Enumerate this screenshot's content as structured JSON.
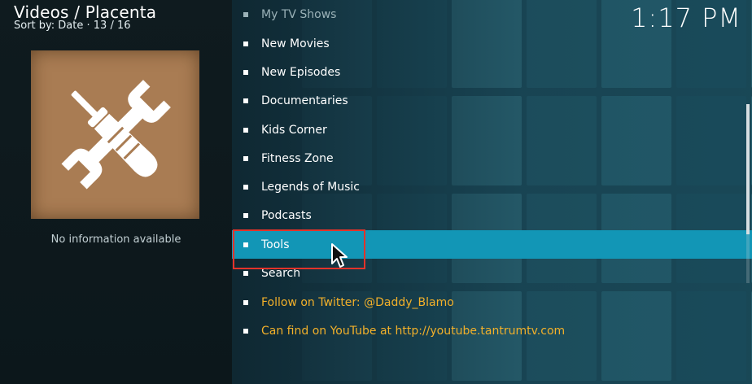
{
  "header": {
    "title": "Videos / Placenta",
    "sort_label": "Sort by: Date",
    "position": "13 / 16",
    "clock": "1:17 PM"
  },
  "info_panel": {
    "poster_icon": "tools-icon",
    "no_info_text": "No information available"
  },
  "menu": {
    "items": [
      {
        "label": "My TV Shows",
        "state": "dim"
      },
      {
        "label": "New Movies"
      },
      {
        "label": "New Episodes"
      },
      {
        "label": "Documentaries"
      },
      {
        "label": "Kids Corner"
      },
      {
        "label": "Fitness Zone"
      },
      {
        "label": "Legends of Music"
      },
      {
        "label": "Podcasts"
      },
      {
        "label": "Tools",
        "state": "selected"
      },
      {
        "label": "Search"
      },
      {
        "label": "Follow on Twitter: @Daddy_Blamo",
        "state": "link"
      },
      {
        "label": "Can find on YouTube at http://youtube.tantrumtv.com",
        "state": "link"
      }
    ]
  },
  "colors": {
    "selected_bg": "#1296b6",
    "link_text": "#f2b02a",
    "highlight_border": "#e3332a",
    "poster_bg": "#a97c53"
  }
}
